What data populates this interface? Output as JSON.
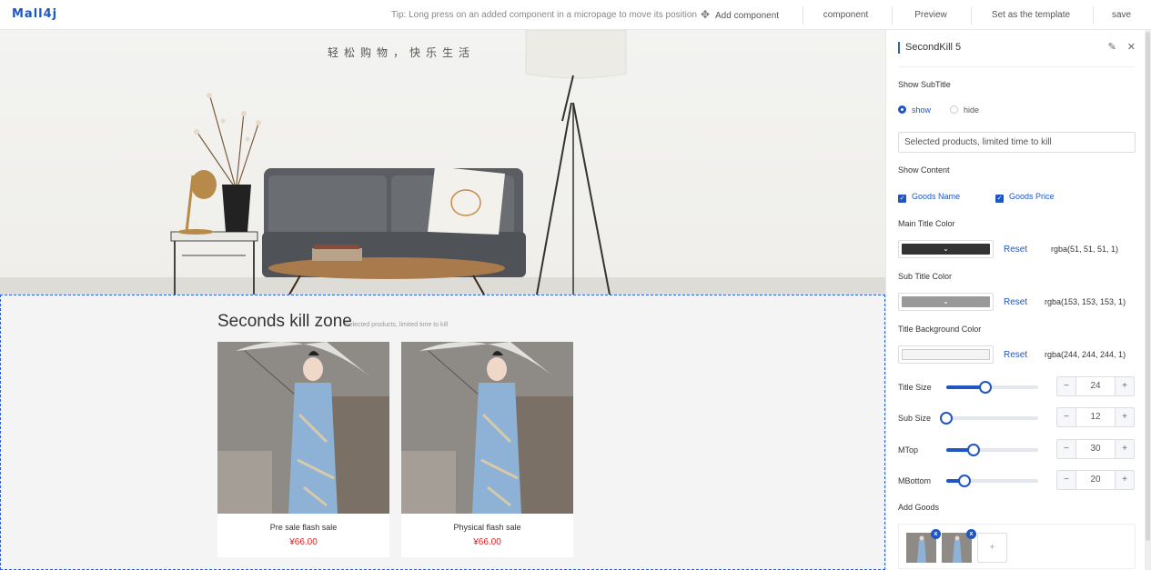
{
  "app": {
    "logo": "Mall4j"
  },
  "topbar": {
    "tip": "Tip: Long press on an added component in a micropage to move its position",
    "add_component": "Add component",
    "component": "component",
    "preview": "Preview",
    "set_template": "Set as the template",
    "save": "save"
  },
  "canvas": {
    "banner_slogan": "轻松购物，快乐生活",
    "seckill": {
      "title": "Seconds kill zone",
      "subtitle": "Selected products, limited time to kill",
      "products": [
        {
          "name": "Pre sale flash sale",
          "price": "¥66.00"
        },
        {
          "name": "Physical flash sale",
          "price": "¥66.00"
        }
      ]
    }
  },
  "panel": {
    "title": "SecondKill 5",
    "show_subtitle_label": "Show SubTitle",
    "radio_show": "show",
    "radio_hide": "hide",
    "subtitle_value": "Selected products, limited time to kill",
    "show_content_label": "Show Content",
    "check_goods_name": "Goods Name",
    "check_goods_price": "Goods Price",
    "main_title_color_label": "Main Title Color",
    "main_title_color": "rgba(51, 51, 51, 1)",
    "sub_title_color_label": "Sub Title Color",
    "sub_title_color": "rgba(153, 153, 153, 1)",
    "title_bg_color_label": "Title Background Color",
    "title_bg_color": "rgba(244, 244, 244, 1)",
    "reset": "Reset",
    "title_size_label": "Title Size",
    "title_size": "24",
    "sub_size_label": "Sub Size",
    "sub_size": "12",
    "mtop_label": "MTop",
    "mtop": "30",
    "mbottom_label": "MBottom",
    "mbottom": "20",
    "add_goods_label": "Add Goods",
    "minus": "−",
    "plus": "+",
    "add_plus": "+",
    "remove": "x"
  },
  "colors": {
    "accent": "#1f55c4",
    "price": "#e02020",
    "main_title": "#333333",
    "sub_title": "#999999",
    "title_bg": "#f4f4f4"
  },
  "icons": {
    "edit": "edit-icon",
    "close": "close-icon",
    "add_component": "move-icon",
    "dropdown": "chevron-down-icon"
  }
}
